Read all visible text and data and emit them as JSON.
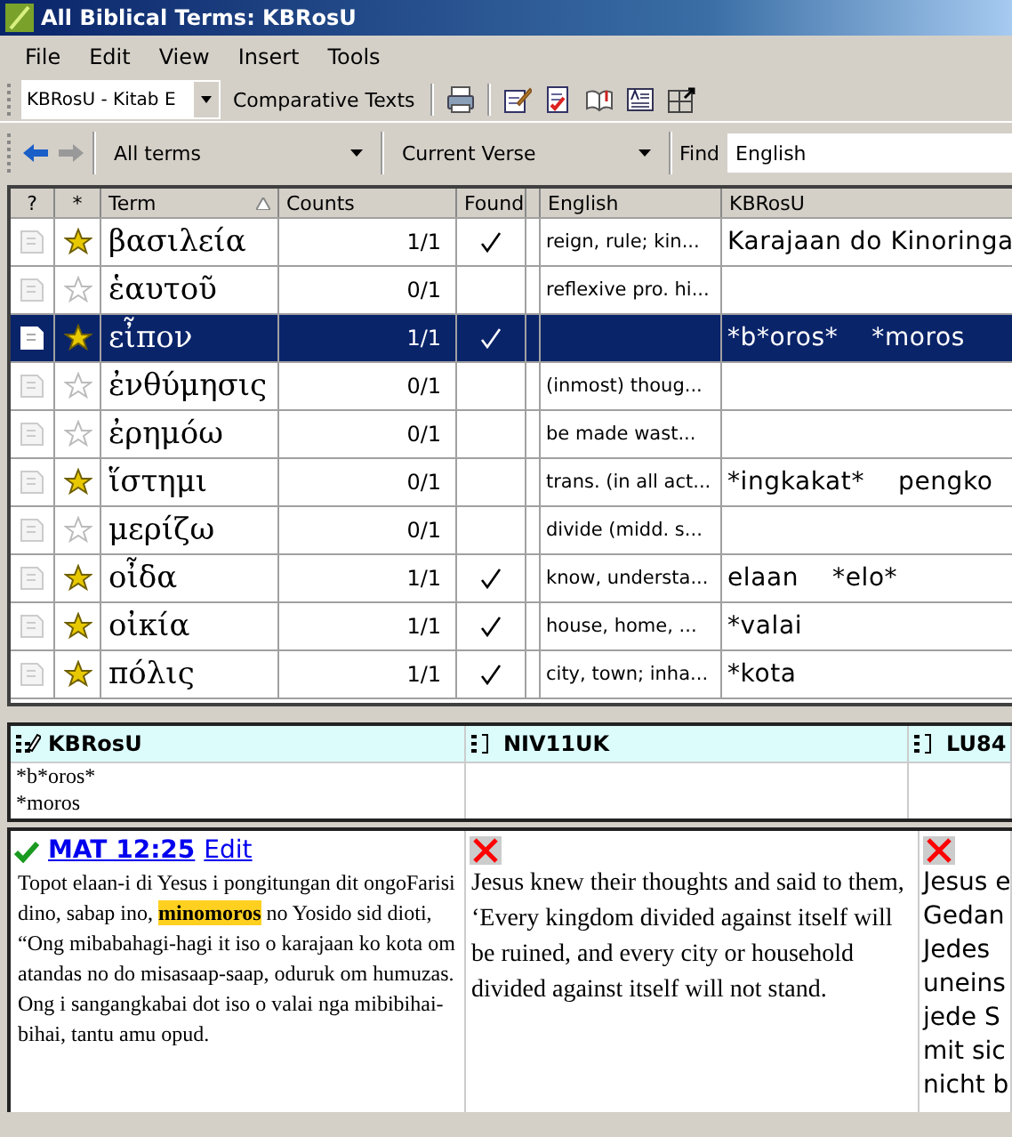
{
  "window": {
    "title": "All Biblical Terms: KBRosU"
  },
  "menu": [
    {
      "label": "File"
    },
    {
      "label": "Edit"
    },
    {
      "label": "View"
    },
    {
      "label": "Insert"
    },
    {
      "label": "Tools"
    }
  ],
  "toolbar": {
    "project": "KBRosU - Kitab E",
    "comparative_texts": "Comparative Texts"
  },
  "filter_bar": {
    "filter": "All terms",
    "scope": "Current Verse",
    "find_label": "Find",
    "find_value": "English"
  },
  "table": {
    "columns": [
      "?",
      "*",
      "Term",
      "Counts",
      "Found",
      "English",
      "KBRosU"
    ],
    "rows": [
      {
        "term": "βασιλεία",
        "counts": "1/1",
        "found": true,
        "english": "reign, rule; kin...",
        "rendering": "Karajaan do Kinoringa",
        "starred": true,
        "selected": false
      },
      {
        "term": "ἑαυτοῦ",
        "counts": "0/1",
        "found": false,
        "english": "reflexive pro. hi...",
        "starred": false,
        "selected": false
      },
      {
        "term": "εἶπον",
        "counts": "1/1",
        "found": true,
        "rendering": "*b*oros*    *moros",
        "starred": true,
        "selected": true
      },
      {
        "term": "ἐνθύμησις",
        "counts": "0/1",
        "found": false,
        "english": "(inmost) thoug...",
        "starred": false,
        "selected": false
      },
      {
        "term": "ἐρημόω",
        "counts": "0/1",
        "found": false,
        "english": "be made wast...",
        "starred": false,
        "selected": false
      },
      {
        "term": "ἵστημι",
        "counts": "0/1",
        "found": false,
        "english": "trans. (in all act...",
        "rendering": "*ingkakat*    pengko",
        "starred": true,
        "selected": false
      },
      {
        "term": "μερίζω",
        "counts": "0/1",
        "found": false,
        "english": "divide (midd. s...",
        "starred": false,
        "selected": false
      },
      {
        "term": "οἶδα",
        "counts": "1/1",
        "found": true,
        "english": "know, understa...",
        "rendering": "elaan    *elo*",
        "starred": true,
        "selected": false
      },
      {
        "term": "οἰκία",
        "counts": "1/1",
        "found": true,
        "english": "house, home, ...",
        "rendering": "*valai",
        "starred": true,
        "selected": false
      },
      {
        "term": "πόλις",
        "counts": "1/1",
        "found": true,
        "english": "city, town; inha...",
        "rendering": "*kota",
        "starred": true,
        "selected": false
      }
    ]
  },
  "renderings": [
    {
      "name": "KBRosU",
      "kind": "editable",
      "text": "*b*oros*\n*moros"
    },
    {
      "name": "NIV11UK",
      "kind": "readonly"
    },
    {
      "name": "LU84",
      "kind": "readonly"
    }
  ],
  "verses": [
    {
      "found": true,
      "reference": "MAT 12:25",
      "edit": "Edit",
      "text": "Topot elaan-i di Yesus i pongitungan dit ongoFarisi dino, sabap ino, **minomoros** no Yosido sid dioti, “Ong mibabahagi-hagi it iso o karajaan ko kota om atandas no do misasaap-saap, oduruk om humuzas. Ong i sangangkabai dot iso o valai nga mibibihai-bihai, tantu amu opud."
    },
    {
      "found": false,
      "text": "Jesus knew their thoughts and said to them, ‘Every kingdom divided against itself will be ruined, and every city or household divided against itself will not stand."
    },
    {
      "found": false,
      "lines": [
        "Jesus e",
        "Gedan",
        "Jedes",
        "uneins",
        "jede S",
        "mit sic",
        "nicht b"
      ]
    }
  ]
}
